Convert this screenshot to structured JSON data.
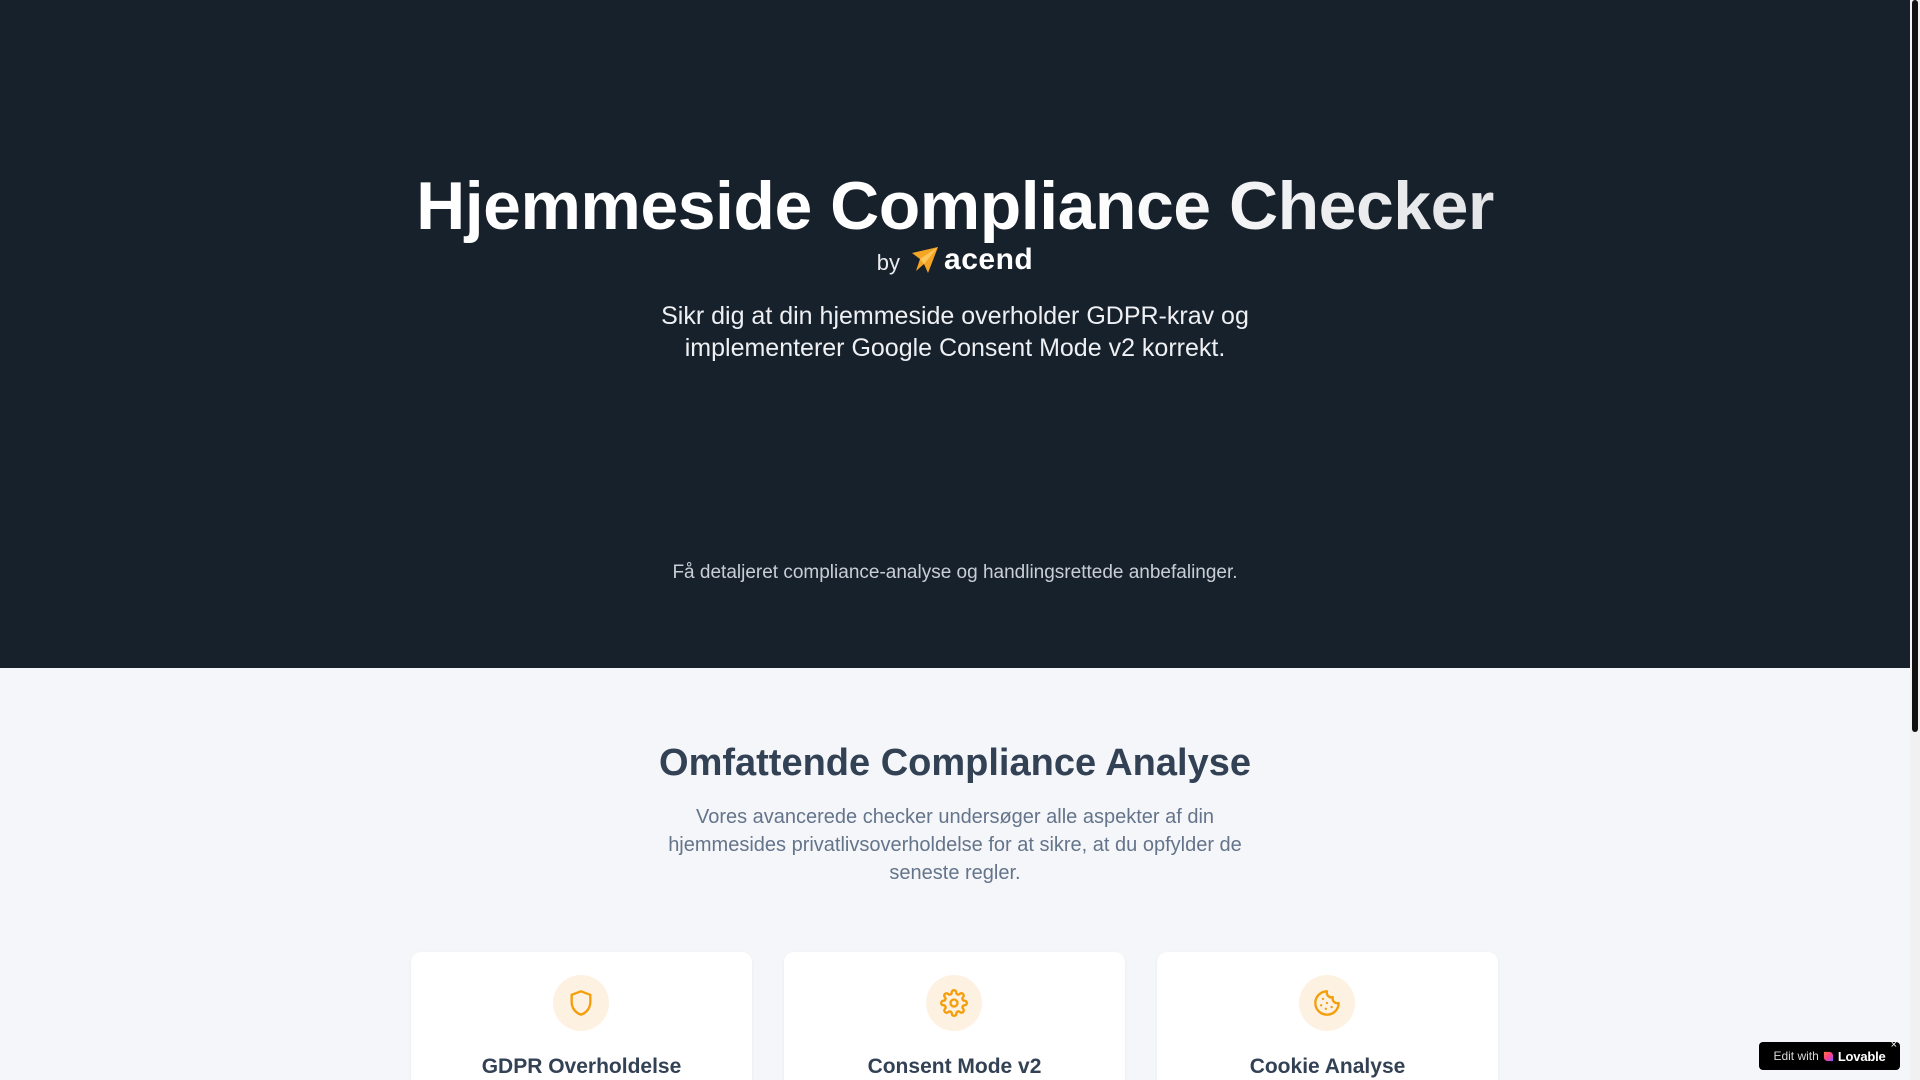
{
  "hero": {
    "title": "Hjemmeside Compliance Checker",
    "by": "by",
    "brand": "acend",
    "subtitle": "Sikr dig at din hjemmeside overholder GDPR-krav og implementerer Google Consent Mode v2 korrekt.",
    "note": "Få detaljeret compliance-analyse og handlingsrettede anbefalinger."
  },
  "features": {
    "title": "Omfattende Compliance Analyse",
    "description": "Vores avancerede checker undersøger alle aspekter af din hjemmesides privatlivsoverholdelse for at sikre, at du opfylder de seneste regler.",
    "cards": [
      {
        "title": "GDPR Overholdelse",
        "icon": "shield-icon"
      },
      {
        "title": "Consent Mode v2",
        "icon": "gear-icon"
      },
      {
        "title": "Cookie Analyse",
        "icon": "cookie-icon"
      }
    ]
  },
  "badge": {
    "edit_text": "Edit with",
    "brand": "Lovable",
    "close": "×"
  },
  "colors": {
    "hero_bg": "#17212b",
    "accent": "#f59e0b",
    "icon_bg": "#fdf1e1",
    "page_bg": "#f5f6f9"
  }
}
